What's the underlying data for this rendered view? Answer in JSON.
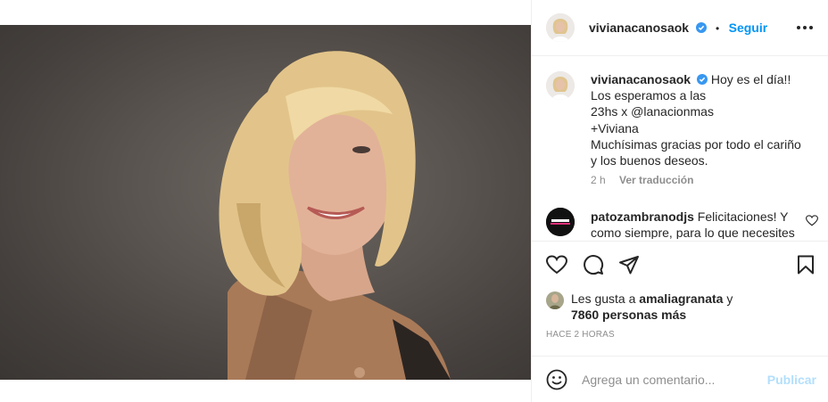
{
  "post": {
    "username": "vivianacanosaok",
    "follow_label": "Seguir",
    "dot": "•",
    "caption_lines": [
      "Hoy es el día!!",
      "Los esperamos a las",
      "23hs x @lanacionmas",
      "+Viviana",
      "Muchísimas gracias por todo el cariño",
      "y los buenos deseos."
    ],
    "caption_time": "2 h",
    "translate_label": "Ver traducción"
  },
  "comment": {
    "username": "patozambranodjs",
    "text": "Felicitaciones! Y como siempre, para lo que necesites"
  },
  "likes": {
    "prefix": "Les gusta a",
    "liker": "amaliagranata",
    "suffix": "y",
    "others": "7860 personas más"
  },
  "timestamp": "HACE 2 HORAS",
  "composer": {
    "placeholder": "Agrega un comentario...",
    "publish_label": "Publicar"
  },
  "colors": {
    "accent": "#0095f6",
    "verified": "#3897f0",
    "publish_disabled": "#b2dffc"
  },
  "icons": [
    "more-options-icon",
    "heart-icon",
    "comment-icon",
    "share-icon",
    "bookmark-icon",
    "emoji-icon",
    "verified-icon"
  ]
}
